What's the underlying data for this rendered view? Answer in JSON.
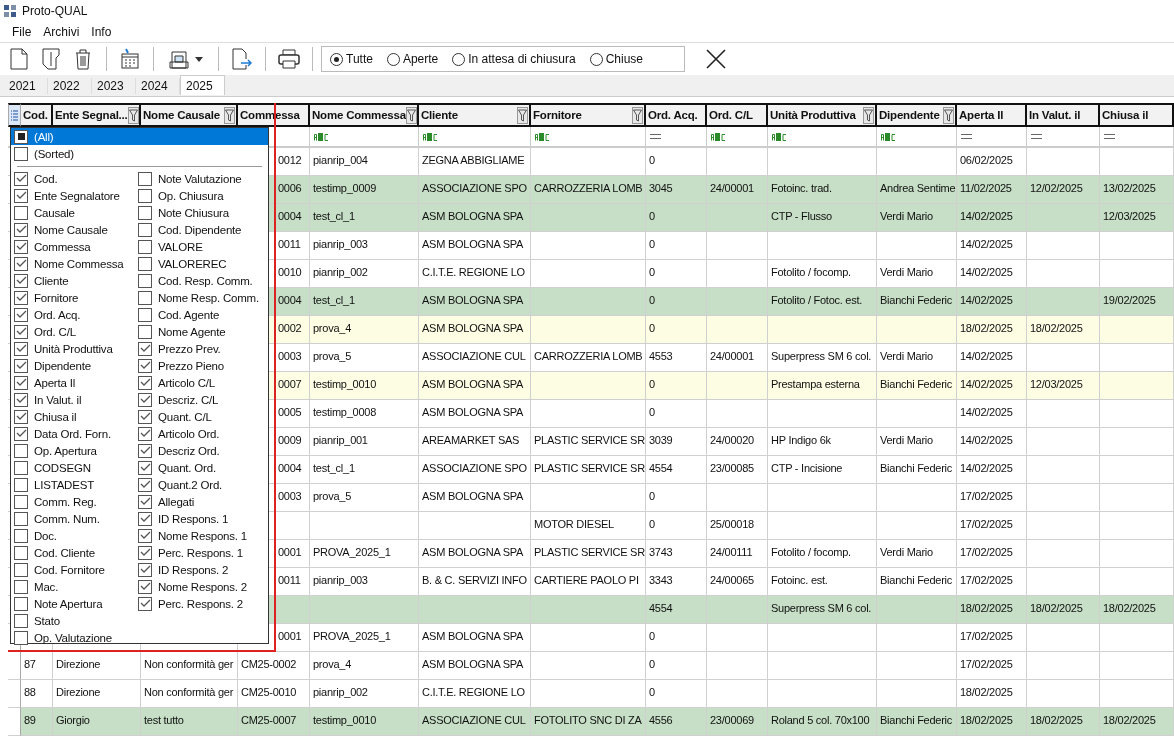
{
  "window": {
    "title": "Proto-QUAL"
  },
  "menu": [
    "File",
    "Archivi",
    "Info"
  ],
  "filter_options": [
    {
      "label": "Tutte",
      "selected": true
    },
    {
      "label": "Aperte",
      "selected": false
    },
    {
      "label": "In attesa di chiusura",
      "selected": false
    },
    {
      "label": "Chiuse",
      "selected": false
    }
  ],
  "year_tabs": [
    {
      "label": "2021",
      "selected": false
    },
    {
      "label": "2022",
      "selected": false
    },
    {
      "label": "2023",
      "selected": false
    },
    {
      "label": "2024",
      "selected": false
    },
    {
      "label": "2025",
      "selected": true
    }
  ],
  "grid": {
    "columns": [
      {
        "label": "Cod.",
        "filter_button": false
      },
      {
        "label": "Ente Segnal...",
        "filter_button": true
      },
      {
        "label": "Nome Causale",
        "filter_button": true
      },
      {
        "label": "Commessa",
        "filter_button": false
      },
      {
        "label": "Nome Commessa",
        "filter_button": true,
        "kind": "text"
      },
      {
        "label": "Cliente",
        "filter_button": true,
        "kind": "text"
      },
      {
        "label": "Fornitore",
        "filter_button": true,
        "kind": "text"
      },
      {
        "label": "Ord. Acq.",
        "filter_button": false,
        "kind": "equals"
      },
      {
        "label": "Ord. C/L",
        "filter_button": false,
        "kind": "text"
      },
      {
        "label": "Unità Produttiva",
        "filter_button": true,
        "kind": "text"
      },
      {
        "label": "Dipendente",
        "filter_button": true,
        "kind": "text"
      },
      {
        "label": "Aperta Il",
        "filter_button": false,
        "kind": "equals"
      },
      {
        "label": "In Valut. il",
        "filter_button": false,
        "kind": "equals"
      },
      {
        "label": "Chiusa il",
        "filter_button": false,
        "kind": "equals"
      }
    ],
    "rows": [
      {
        "color": "#ffffff",
        "covered": true,
        "cells": [
          "",
          "",
          "",
          "0012",
          "pianrip_004",
          "ZEGNA ABBIGLIAME",
          "",
          "0",
          "",
          "",
          "",
          "06/02/2025",
          "",
          ""
        ]
      },
      {
        "color": "#c6dfc6",
        "covered": true,
        "cells": [
          "",
          "",
          "",
          "0006",
          "testimp_0009",
          "ASSOCIAZIONE SPO",
          "CARROZZERIA LOMB",
          "3045",
          "24/00001",
          "Fotoinc. trad.",
          "Andrea Sentime",
          "11/02/2025",
          "12/02/2025",
          "13/02/2025"
        ]
      },
      {
        "color": "#c6dfc6",
        "covered": true,
        "cells": [
          "",
          "",
          "",
          "0004",
          "test_cl_1",
          "ASM BOLOGNA SPA",
          "",
          "0",
          "",
          "CTP - Flusso",
          "Verdi Mario",
          "14/02/2025",
          "",
          "12/03/2025"
        ]
      },
      {
        "color": "#ffffff",
        "covered": true,
        "cells": [
          "",
          "",
          "",
          "0011",
          "pianrip_003",
          "ASM BOLOGNA SPA",
          "",
          "0",
          "",
          "",
          "",
          "14/02/2025",
          "",
          ""
        ]
      },
      {
        "color": "#ffffff",
        "covered": true,
        "cells": [
          "",
          "",
          "",
          "0010",
          "pianrip_002",
          "C.I.T.E. REGIONE LO",
          "",
          "0",
          "",
          "Fotolito / focomp.",
          "Verdi Mario",
          "14/02/2025",
          "",
          ""
        ]
      },
      {
        "color": "#c6dfc6",
        "covered": true,
        "cells": [
          "",
          "",
          "",
          "0004",
          "test_cl_1",
          "ASM BOLOGNA SPA",
          "",
          "0",
          "",
          "Fotolito / Fotoc. est.",
          "Bianchi Federic",
          "14/02/2025",
          "",
          "19/02/2025"
        ]
      },
      {
        "color": "#fdfde4",
        "covered": true,
        "cells": [
          "",
          "",
          "",
          "0002",
          "prova_4",
          "ASM BOLOGNA SPA",
          "",
          "0",
          "",
          "",
          "",
          "18/02/2025",
          "18/02/2025",
          ""
        ]
      },
      {
        "color": "#ffffff",
        "covered": true,
        "cells": [
          "",
          "",
          "",
          "0003",
          "prova_5",
          "ASSOCIAZIONE CUL",
          "CARROZZERIA LOMB",
          "4553",
          "24/00001",
          "Superpress SM 6 col.",
          "Verdi Mario",
          "14/02/2025",
          "",
          ""
        ]
      },
      {
        "color": "#fdfde4",
        "covered": true,
        "cells": [
          "",
          "",
          "",
          "0007",
          "testimp_0010",
          "ASM BOLOGNA SPA",
          "",
          "0",
          "",
          "Prestampa esterna",
          "Bianchi Federic",
          "14/02/2025",
          "12/03/2025",
          ""
        ]
      },
      {
        "color": "#ffffff",
        "covered": true,
        "cells": [
          "",
          "",
          "",
          "0005",
          "testimp_0008",
          "ASM BOLOGNA SPA",
          "",
          "0",
          "",
          "",
          "",
          "14/02/2025",
          "",
          ""
        ]
      },
      {
        "color": "#ffffff",
        "covered": true,
        "cells": [
          "",
          "",
          "",
          "0009",
          "pianrip_001",
          "AREAMARKET SAS",
          "PLASTIC SERVICE SR",
          "3039",
          "24/00020",
          "HP Indigo 6k",
          "Verdi Mario",
          "14/02/2025",
          "",
          ""
        ]
      },
      {
        "color": "#ffffff",
        "covered": true,
        "cells": [
          "",
          "",
          "",
          "0004",
          "test_cl_1",
          "ASSOCIAZIONE SPO",
          "PLASTIC SERVICE SR",
          "4554",
          "23/00085",
          "CTP - Incisione",
          "Bianchi Federic",
          "14/02/2025",
          "",
          ""
        ]
      },
      {
        "color": "#ffffff",
        "covered": true,
        "cells": [
          "",
          "",
          "",
          "0003",
          "prova_5",
          "ASM BOLOGNA SPA",
          "",
          "0",
          "",
          "",
          "",
          "17/02/2025",
          "",
          ""
        ]
      },
      {
        "color": "#ffffff",
        "covered": true,
        "cells": [
          "",
          "",
          "",
          "",
          "",
          "",
          "MOTOR DIESEL",
          "0",
          "25/00018",
          "",
          "",
          "17/02/2025",
          "",
          ""
        ]
      },
      {
        "color": "#ffffff",
        "covered": true,
        "cells": [
          "",
          "",
          "",
          "0001",
          "PROVA_2025_1",
          "ASM BOLOGNA SPA",
          "PLASTIC SERVICE SR",
          "3743",
          "24/00111",
          "Fotolito / focomp.",
          "Verdi Mario",
          "17/02/2025",
          "",
          ""
        ]
      },
      {
        "color": "#ffffff",
        "covered": true,
        "cells": [
          "",
          "",
          "",
          "0011",
          "pianrip_003",
          "B. & C. SERVIZI INFO",
          "CARTIERE PAOLO PI",
          "3343",
          "24/00065",
          "Fotoinc. est.",
          "Bianchi Federic",
          "17/02/2025",
          "",
          ""
        ]
      },
      {
        "color": "#c6dfc6",
        "covered": true,
        "cells": [
          "",
          "",
          "",
          "",
          "",
          "",
          "",
          "4554",
          "",
          "Superpress SM 6 col.",
          "",
          "18/02/2025",
          "18/02/2025",
          "18/02/2025"
        ]
      },
      {
        "color": "#ffffff",
        "covered": true,
        "cells": [
          "",
          "",
          "",
          "0001",
          "PROVA_2025_1",
          "ASM BOLOGNA SPA",
          "",
          "0",
          "",
          "",
          "",
          "17/02/2025",
          "",
          ""
        ]
      },
      {
        "color": "#ffffff",
        "covered": false,
        "cells": [
          "87",
          "Direzione",
          "Non conformità ger",
          "CM25-0002",
          "prova_4",
          "ASM BOLOGNA SPA",
          "",
          "0",
          "",
          "",
          "",
          "17/02/2025",
          "",
          ""
        ]
      },
      {
        "color": "#ffffff",
        "covered": false,
        "cells": [
          "88",
          "Direzione",
          "Non conformità ger",
          "CM25-0010",
          "pianrip_002",
          "C.I.T.E. REGIONE LO",
          "",
          "0",
          "",
          "",
          "",
          "18/02/2025",
          "",
          ""
        ]
      },
      {
        "color": "#c6dfc6",
        "covered": false,
        "cells": [
          "89",
          "Giorgio",
          "test tutto",
          "CM25-0007",
          "testimp_0010",
          "ASSOCIAZIONE CUL",
          "FOTOLITO SNC DI ZA",
          "4556",
          "23/00069",
          "Roland 5 col. 70x100",
          "Bianchi Federic",
          "18/02/2025",
          "18/02/2025",
          "18/02/2025"
        ]
      }
    ]
  },
  "column_chooser": {
    "special": [
      {
        "label": "(All)",
        "indeterminate": true,
        "selected": true
      },
      {
        "label": "(Sorted)",
        "indeterminate": false,
        "selected": false
      }
    ],
    "items": [
      {
        "label": "Cod.",
        "checked": true
      },
      {
        "label": "Ente Segnalatore",
        "checked": true
      },
      {
        "label": "Causale",
        "checked": false
      },
      {
        "label": "Nome Causale",
        "checked": true
      },
      {
        "label": "Commessa",
        "checked": true
      },
      {
        "label": "Nome Commessa",
        "checked": true
      },
      {
        "label": "Cliente",
        "checked": true
      },
      {
        "label": "Fornitore",
        "checked": true
      },
      {
        "label": "Ord. Acq.",
        "checked": true
      },
      {
        "label": "Ord. C/L",
        "checked": true
      },
      {
        "label": "Unità Produttiva",
        "checked": true
      },
      {
        "label": "Dipendente",
        "checked": true
      },
      {
        "label": "Aperta Il",
        "checked": true
      },
      {
        "label": "In Valut. il",
        "checked": true
      },
      {
        "label": "Chiusa il",
        "checked": true
      },
      {
        "label": "Data Ord. Forn.",
        "checked": true
      },
      {
        "label": "Op. Apertura",
        "checked": false
      },
      {
        "label": "CODSEGN",
        "checked": false
      },
      {
        "label": "LISTADEST",
        "checked": false
      },
      {
        "label": "Comm. Reg.",
        "checked": false
      },
      {
        "label": "Comm. Num.",
        "checked": false
      },
      {
        "label": "Doc.",
        "checked": false
      },
      {
        "label": "Cod. Cliente",
        "checked": false
      },
      {
        "label": "Cod. Fornitore",
        "checked": false
      },
      {
        "label": "Mac.",
        "checked": false
      },
      {
        "label": "Note Apertura",
        "checked": false
      },
      {
        "label": "Stato",
        "checked": false
      },
      {
        "label": "Op. Valutazione",
        "checked": false
      },
      {
        "label": "Note Valutazione",
        "checked": false
      },
      {
        "label": "Op. Chiusura",
        "checked": false
      },
      {
        "label": "Note Chiusura",
        "checked": false
      },
      {
        "label": "Cod. Dipendente",
        "checked": false
      },
      {
        "label": "VALORE",
        "checked": false
      },
      {
        "label": "VALOREREC",
        "checked": false
      },
      {
        "label": "Cod. Resp. Comm.",
        "checked": false
      },
      {
        "label": "Nome Resp. Comm.",
        "checked": false
      },
      {
        "label": "Cod. Agente",
        "checked": false
      },
      {
        "label": "Nome Agente",
        "checked": false
      },
      {
        "label": "Prezzo Prev.",
        "checked": true
      },
      {
        "label": "Prezzo Pieno",
        "checked": true
      },
      {
        "label": "Articolo C/L",
        "checked": true
      },
      {
        "label": "Descriz. C/L",
        "checked": true
      },
      {
        "label": "Quant. C/L",
        "checked": true
      },
      {
        "label": "Articolo Ord.",
        "checked": true
      },
      {
        "label": "Descriz Ord.",
        "checked": true
      },
      {
        "label": "Quant. Ord.",
        "checked": true
      },
      {
        "label": "Quant.2 Ord.",
        "checked": true
      },
      {
        "label": "Allegati",
        "checked": true
      },
      {
        "label": "ID Respons. 1",
        "checked": true
      },
      {
        "label": "Nome Respons. 1",
        "checked": true
      },
      {
        "label": "Perc. Respons. 1",
        "checked": true
      },
      {
        "label": "ID Respons. 2",
        "checked": true
      },
      {
        "label": "Nome Respons. 2",
        "checked": true
      },
      {
        "label": "Perc. Respons. 2",
        "checked": true
      }
    ]
  }
}
